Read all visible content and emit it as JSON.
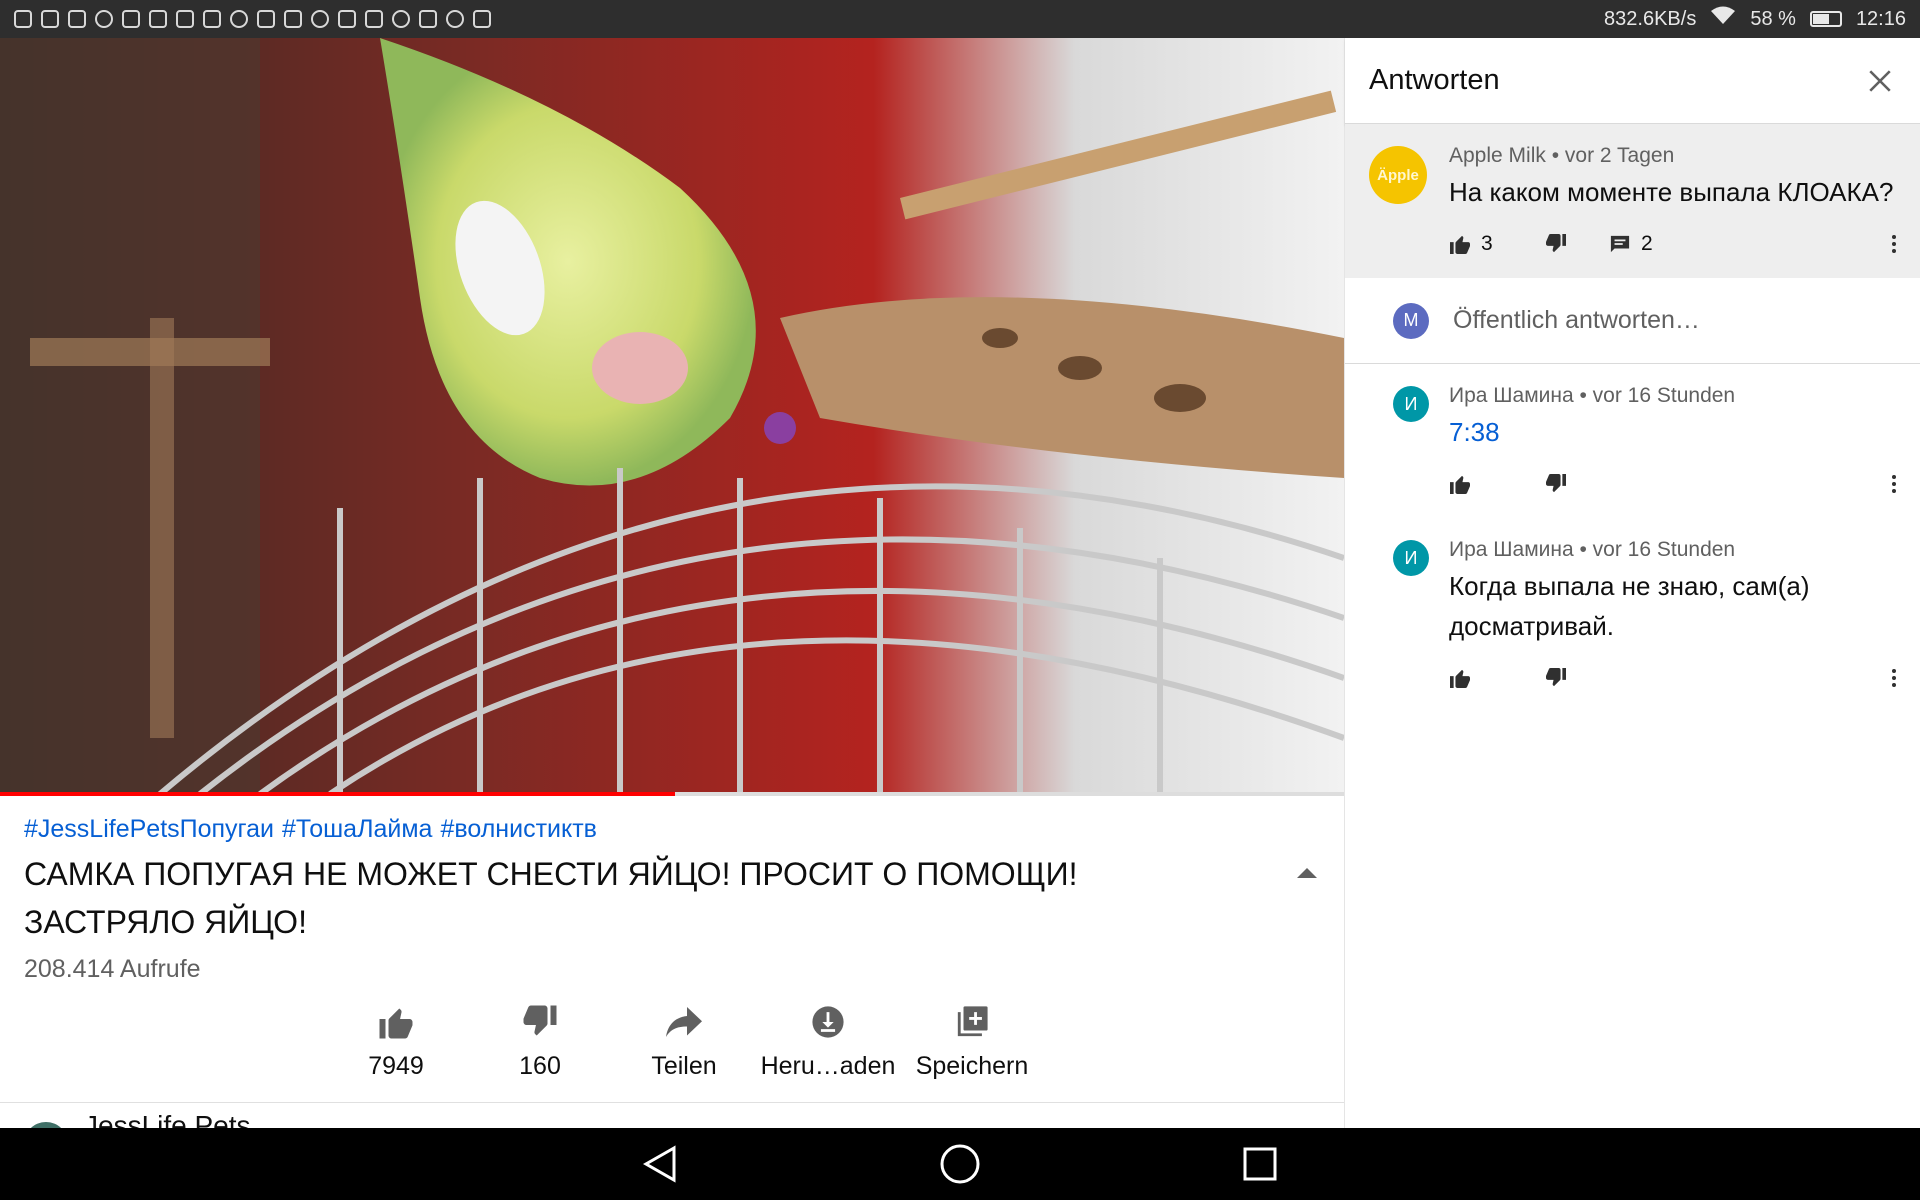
{
  "status_bar": {
    "network_speed": "832.6KB/s",
    "battery_percent": "58 %",
    "battery_level": 0.58,
    "time": "12:16",
    "notification_icons": [
      "instagram-icon",
      "instagram-icon",
      "gallery-icon",
      "chrome-icon",
      "mail-icon",
      "game-icon",
      "rss-icon",
      "news-icon",
      "chrome-icon",
      "video-icon",
      "rss-icon",
      "chrome-icon",
      "pinwheel-icon",
      "instagram-icon",
      "chrome-icon",
      "mail-icon",
      "chrome-icon",
      "news-icon"
    ]
  },
  "video": {
    "progress": 0.502,
    "buffered": 0.577
  },
  "details": {
    "hashtags": [
      "#JessLifePetsПопугаи",
      "#ТошаЛайма",
      "#волнистиктв"
    ],
    "title": "САМКА ПОПУГАЯ НЕ МОЖЕТ СНЕСТИ ЯЙЦО! ПРОСИТ О ПОМОЩИ! ЗАСТРЯЛО ЯЙЦО!",
    "views": "208.414 Aufrufe",
    "actions": {
      "like": "7949",
      "dislike": "160",
      "share": "Teilen",
      "download": "Heru…aden",
      "save": "Speichern"
    },
    "channel_name": "JessLife Pets"
  },
  "panel": {
    "title": "Antworten",
    "parent_comment": {
      "avatar_text": "Äpple",
      "meta": "Apple Milk • vor 2 Tagen",
      "text": "На каком моменте выпала КЛОАКА?",
      "likes": "3",
      "replies": "2"
    },
    "reply_box": {
      "avatar_letter": "M",
      "placeholder": "Öffentlich antworten…"
    },
    "replies": [
      {
        "avatar_letter": "И",
        "meta": "Ира Шамина • vor 16 Stunden",
        "text": "7:38",
        "is_link": true
      },
      {
        "avatar_letter": "И",
        "meta": "Ира Шамина • vor 16 Stunden",
        "text": "Когда выпала не знаю, сам(а) досматривай.",
        "is_link": false
      }
    ]
  },
  "colors": {
    "link": "#065fd4",
    "progress": "#ff0000",
    "reply_avatar": "#0097a7",
    "own_avatar": "#5c6bc0",
    "apple_avatar": "#f5c400"
  }
}
